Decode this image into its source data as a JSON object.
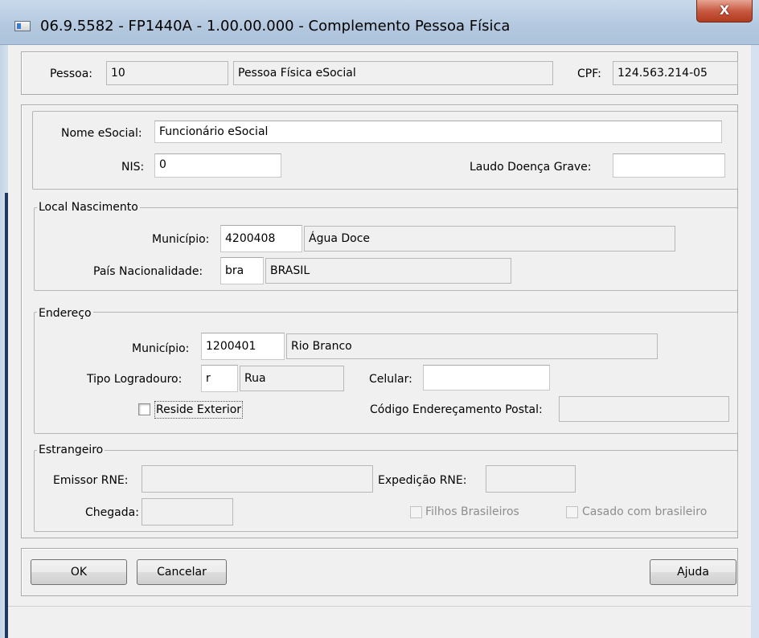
{
  "window": {
    "title": "06.9.5582 - FP1440A - 1.00.00.000 - Complemento Pessoa Física",
    "close_label": "X"
  },
  "header": {
    "pessoa_label": "Pessoa:",
    "pessoa_value": "10",
    "pessoa_nome": "Pessoa Física eSocial",
    "cpf_label": "CPF:",
    "cpf_value": "124.563.214-05"
  },
  "identificacao": {
    "nome_label": "Nome eSocial:",
    "nome_value": "Funcionário eSocial",
    "nis_label": "NIS:",
    "nis_value": "0",
    "laudo_label": "Laudo Doença Grave:",
    "laudo_value": ""
  },
  "local_nascimento": {
    "legend": "Local Nascimento",
    "municipio_label": "Município:",
    "municipio_codigo": "4200408",
    "municipio_nome": "Água Doce",
    "pais_label": "País Nacionalidade:",
    "pais_codigo": "bra",
    "pais_nome": "BRASIL"
  },
  "endereco": {
    "legend": "Endereço",
    "municipio_label": "Município:",
    "municipio_codigo": "1200401",
    "municipio_nome": "Rio Branco",
    "tipo_label": "Tipo Logradouro:",
    "tipo_codigo": "r",
    "tipo_nome": "Rua",
    "celular_label": "Celular:",
    "celular_value": "",
    "reside_exterior_label": "Reside Exterior",
    "reside_exterior_checked": false,
    "cep_label": "Código Endereçamento Postal:",
    "cep_value": ""
  },
  "estrangeiro": {
    "legend": "Estrangeiro",
    "emissor_label": "Emissor RNE:",
    "emissor_value": "",
    "expedicao_label": "Expedição RNE:",
    "expedicao_value": "",
    "chegada_label": "Chegada:",
    "chegada_value": "",
    "filhos_label": "Filhos Brasileiros",
    "casado_label": "Casado com brasileiro"
  },
  "buttons": {
    "ok": "OK",
    "cancelar": "Cancelar",
    "ajuda": "Ajuda"
  }
}
